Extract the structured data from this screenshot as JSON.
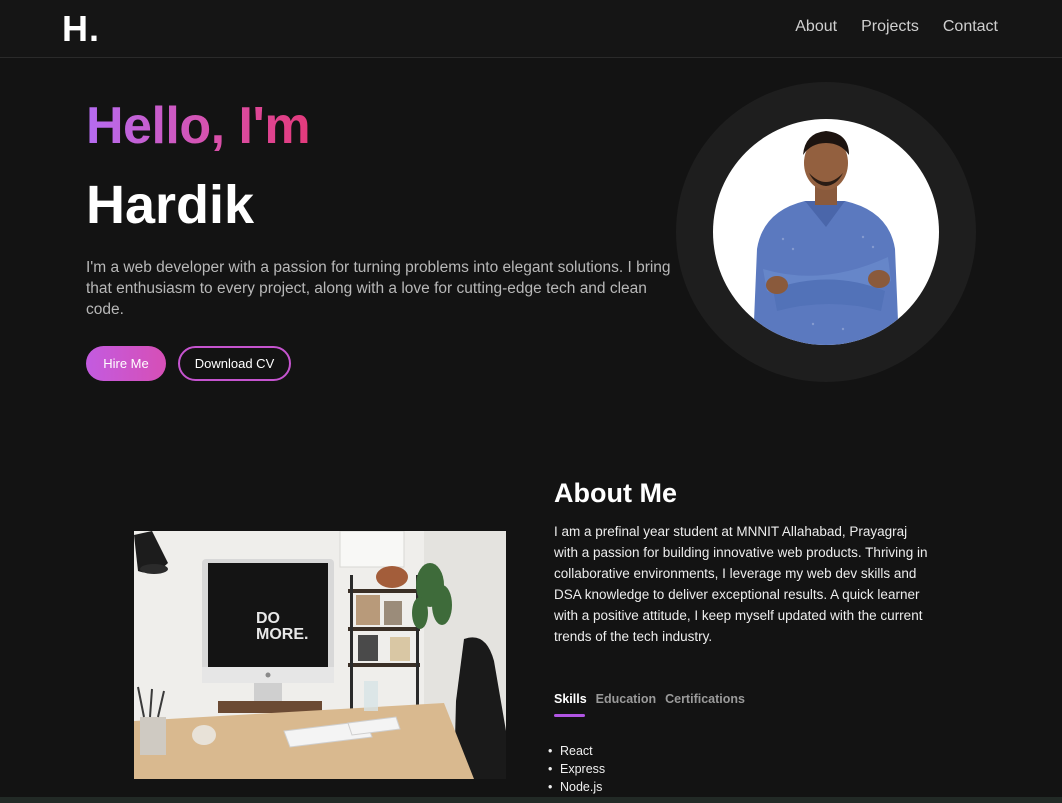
{
  "nav": {
    "logo": "H.",
    "links": [
      "About",
      "Projects",
      "Contact"
    ]
  },
  "hero": {
    "greeting": "Hello, I'm",
    "name": "Hardik",
    "intro": "I'm a web developer with a passion for turning problems into elegant solutions. I bring that enthusiasm to every project, along with a love for cutting-edge tech and clean code.",
    "hire_label": "Hire Me",
    "cv_label": "Download CV"
  },
  "about": {
    "title": "About Me",
    "text": "I am a prefinal year student at MNNIT Allahabad, Prayagraj with a passion for building innovative web products. Thriving in collaborative environments, I leverage my web dev skills and DSA knowledge to deliver exceptional results. A quick learner with a positive attitude, I keep myself updated with the current trends of the tech industry.",
    "tabs": [
      "Skills",
      "Education",
      "Certifications"
    ],
    "active_tab": "Skills",
    "skills": [
      "React",
      "Express",
      "Node.js"
    ],
    "monitor_text_line1": "DO",
    "monitor_text_line2": "MORE."
  },
  "colors": {
    "accent_purple": "#b56cf2",
    "accent_pink": "#e33a7b",
    "background": "#131313",
    "tab_underline": "#b155e3"
  }
}
